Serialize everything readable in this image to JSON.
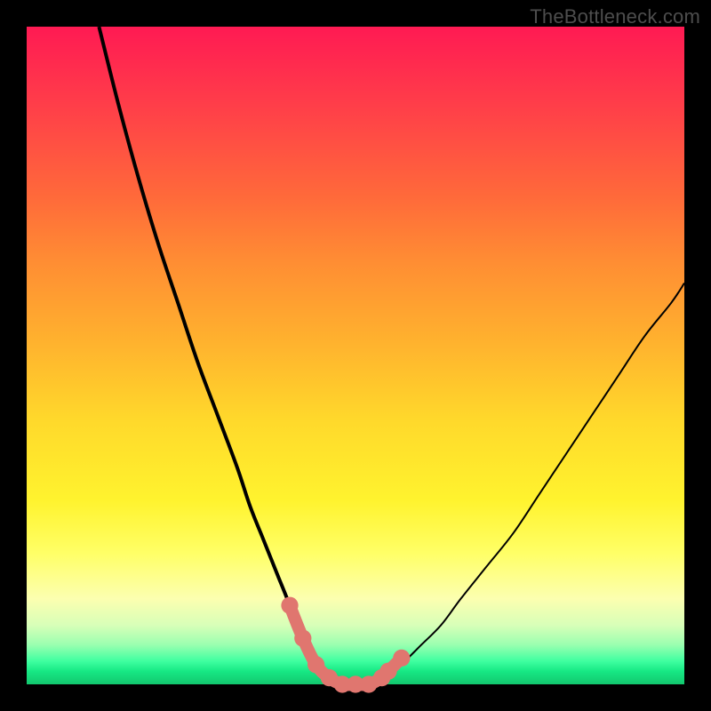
{
  "watermark": "TheBottleneck.com",
  "chart_data": {
    "type": "line",
    "title": "",
    "xlabel": "",
    "ylabel": "",
    "xlim": [
      0,
      100
    ],
    "ylim": [
      0,
      100
    ],
    "series": [
      {
        "name": "left-curve",
        "x": [
          11,
          14,
          17,
          20,
          23,
          26,
          29,
          32,
          34,
          36,
          38,
          40,
          41,
          42,
          43,
          44,
          45,
          46
        ],
        "values": [
          100,
          88,
          77,
          67,
          58,
          49,
          41,
          33,
          27,
          22,
          17,
          12,
          9,
          7,
          5,
          3,
          2,
          1
        ]
      },
      {
        "name": "flat-minimum",
        "x": [
          46,
          48,
          50,
          52,
          54
        ],
        "values": [
          1,
          0,
          0,
          0,
          1
        ]
      },
      {
        "name": "right-curve",
        "x": [
          54,
          56,
          58,
          60,
          63,
          66,
          70,
          74,
          78,
          82,
          86,
          90,
          94,
          98,
          100
        ],
        "values": [
          1,
          2,
          4,
          6,
          9,
          13,
          18,
          23,
          29,
          35,
          41,
          47,
          53,
          58,
          61
        ]
      }
    ],
    "markers": {
      "x": [
        40,
        42,
        44,
        46,
        48,
        50,
        52,
        54,
        55,
        57
      ],
      "values": [
        12,
        7,
        3,
        1,
        0,
        0,
        0,
        1,
        2,
        4
      ],
      "color": "#e0766f"
    },
    "colors": {
      "curve": "#000000",
      "curve_left_width": 4,
      "curve_right_width": 2,
      "markers": "#e0766f"
    }
  }
}
